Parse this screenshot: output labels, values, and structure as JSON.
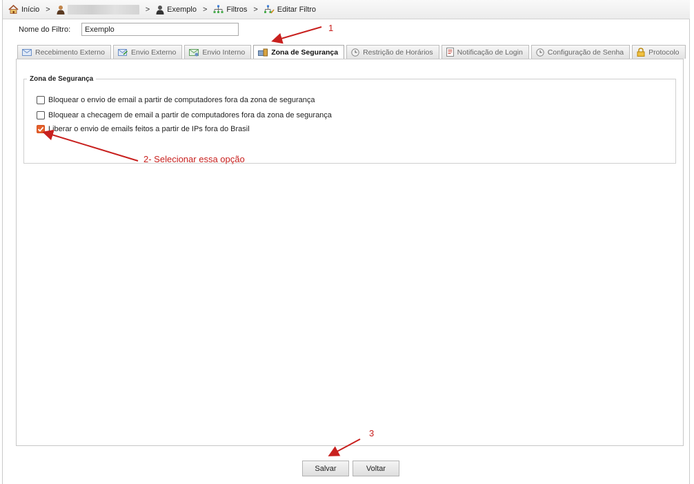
{
  "breadcrumb": {
    "home": "Início",
    "separator": ">",
    "user_icon": "user-icon",
    "example": "Exemplo",
    "filters": "Filtros",
    "edit_filter": "Editar Filtro"
  },
  "filter_name": {
    "label": "Nome do Filtro:",
    "value": "Exemplo"
  },
  "tabs": [
    {
      "label": "Recebimento Externo",
      "icon": "envelope-in-icon",
      "active": false
    },
    {
      "label": "Envio Externo",
      "icon": "envelope-out-icon",
      "active": false
    },
    {
      "label": "Envio Interno",
      "icon": "envelope-internal-icon",
      "active": false
    },
    {
      "label": "Zona de Segurança",
      "icon": "security-zone-icon",
      "active": true
    },
    {
      "label": "Restrição de Horários",
      "icon": "clock-icon",
      "active": false
    },
    {
      "label": "Notificação de Login",
      "icon": "notification-icon",
      "active": false
    },
    {
      "label": "Configuração de Senha",
      "icon": "clock-icon",
      "active": false
    },
    {
      "label": "Protocolo",
      "icon": "lock-icon",
      "active": false
    }
  ],
  "zone": {
    "legend": "Zona de Segurança",
    "options": [
      {
        "label": "Bloquear o envio de email a partir de computadores fora da zona de segurança",
        "checked": false
      },
      {
        "label": "Bloquear a checagem de email a partir de computadores fora da zona de segurança",
        "checked": false
      },
      {
        "label": "Liberar o envio de emails feitos a partir de IPs fora do Brasil",
        "checked": true
      }
    ]
  },
  "buttons": {
    "save": "Salvar",
    "back": "Voltar"
  },
  "annotations": {
    "step1": "1",
    "step2": "2- Selecionar essa opção",
    "step3": "3",
    "color": "#c8201e"
  },
  "colors": {
    "checkbox_checked": "#e5602b"
  }
}
